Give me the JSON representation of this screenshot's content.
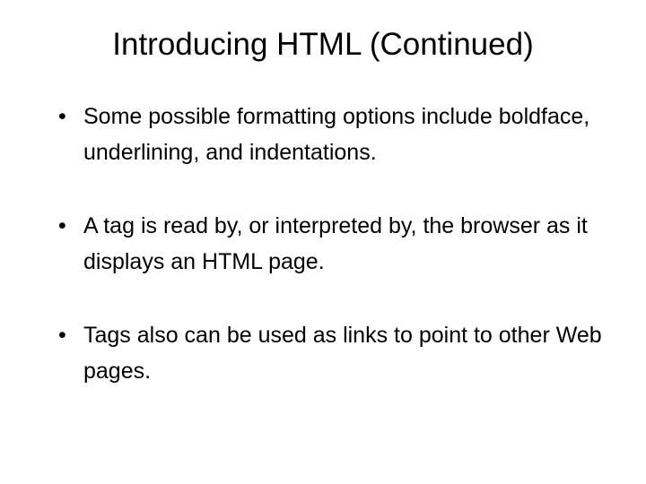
{
  "slide": {
    "title": "Introducing HTML (Continued)",
    "bullets": [
      "Some possible formatting options include boldface, underlining, and indentations.",
      "A tag is read by, or interpreted by, the browser as it displays an HTML page.",
      "Tags also can be used as links to point to other Web pages."
    ]
  }
}
